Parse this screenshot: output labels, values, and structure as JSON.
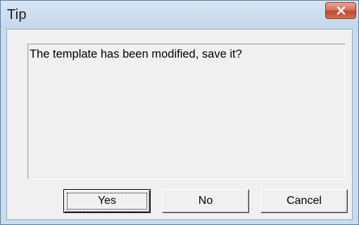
{
  "window": {
    "title": "Tip",
    "close_icon": "close-icon"
  },
  "dialog": {
    "message": "The template has been modified, save it?"
  },
  "buttons": {
    "yes": "Yes",
    "no": "No",
    "cancel": "Cancel"
  },
  "colors": {
    "title_bar": "#c8dcef",
    "close_button": "#c94a2d",
    "dialog_background": "#f0f0f0"
  }
}
